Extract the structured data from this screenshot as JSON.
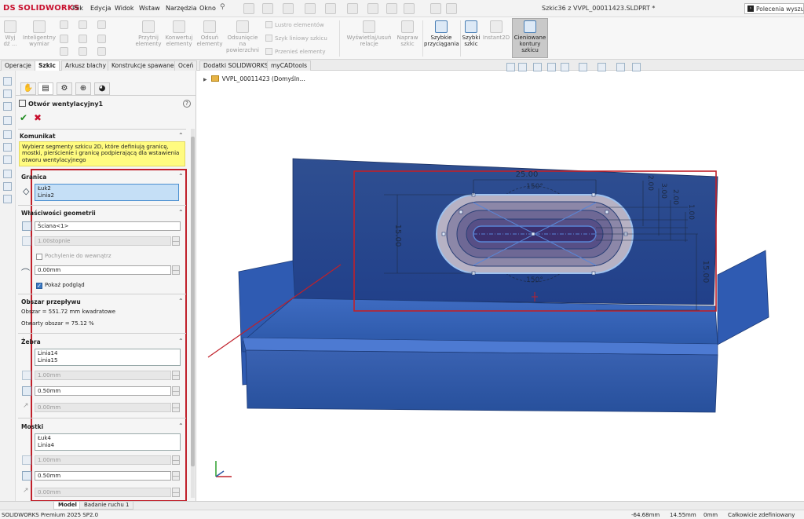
{
  "app": {
    "logo_text": "SOLIDWORKS",
    "document_title": "Szkic36 z VVPL_00011423.SLDPRT *",
    "search_placeholder": "Polecenia wyszuk",
    "menu": [
      "Plik",
      "Edycja",
      "Widok",
      "Wstaw",
      "Narzędzia",
      "Okno"
    ]
  },
  "ribbon": {
    "tools": [
      {
        "label": "Wyj\ndź ...",
        "enabled": false
      },
      {
        "label": "Inteligentny\nwymiar",
        "enabled": false
      },
      {
        "label": "Przytnij\nelementy",
        "enabled": false
      },
      {
        "label": "Konwertuj\nelementy",
        "enabled": false
      },
      {
        "label": "Odsuń\nelementy",
        "enabled": false
      },
      {
        "label": "Odsunięcie\nna\npowierzchni",
        "enabled": false
      },
      {
        "label": "Wyświetlaj/usuń\nrelacje",
        "enabled": false
      },
      {
        "label": "Napraw\nszkic",
        "enabled": false
      },
      {
        "label": "Szybkie\nprzyciągania",
        "enabled": true
      },
      {
        "label": "Szybki\nszkic",
        "enabled": true
      },
      {
        "label": "Instant2D",
        "enabled": false
      },
      {
        "label": "Cieniowane\nkontury\nszkicu",
        "enabled": true,
        "selected": true
      }
    ],
    "small_items": [
      "Lustro elementów",
      "Szyk liniowy szkicu",
      "Przenieś elementy"
    ]
  },
  "command_tabs": [
    "Operacje",
    "Szkic",
    "Arkusz blachy",
    "Konstrukcje spawane",
    "Oceń",
    "Dodatki SOLIDWORKS",
    "myCADtools"
  ],
  "active_tab": "Szkic",
  "property_manager": {
    "title": "Otwór wentylacyjny1",
    "message_title": "Komunikat",
    "message": "Wybierz segmenty szkicu 2D, które definiują granicę, mostki, pierścienie i granicę podpierającą dla wstawienia otworu wentylacyjnego",
    "boundary": {
      "title": "Granica",
      "items": [
        "Łuk2",
        "Linia2"
      ]
    },
    "geometry": {
      "title": "Właściwości geometrii",
      "face": "Ściana<1>",
      "draft_angle": "1.00stopnie",
      "draft_inward_label": "Pochylenie do wewnątrz",
      "fillet_radius": "0.00mm",
      "show_preview_label": "Pokaż podgląd"
    },
    "flow_area": {
      "title": "Obszar przepływu",
      "area": "Obszar = 551.72 mm kwadratowe",
      "open_area": "Otwarty obszar = 75.12 %"
    },
    "ribs": {
      "title": "Żebra",
      "items": [
        "Linia14",
        "Linia15"
      ],
      "depth": "1.00mm",
      "width": "0.50mm",
      "offset": "0.00mm"
    },
    "spars": {
      "title": "Mostki",
      "items": [
        "Łuk4",
        "Linia4"
      ],
      "depth": "1.00mm",
      "width": "0.50mm",
      "offset": "0.00mm"
    }
  },
  "viewport": {
    "tree_item": "VVPL_00011423 (Domyśln...",
    "dimensions": {
      "top_width": "25.00",
      "angle_top": "150°",
      "angle_bottom": "150°",
      "left_height": "15.00",
      "right_height": "15.00",
      "v1": "2.00",
      "v2": "3.00",
      "v3": "2.00",
      "v4": "1.00"
    }
  },
  "bottom_tabs": [
    "Model",
    "Badanie ruchu 1"
  ],
  "status_bar": {
    "product": "SOLIDWORKS Premium 2025 SP2.0",
    "x": "-64.68mm",
    "y": "14.55mm",
    "z": "0mm",
    "state": "Całkowicie zdefiniowany"
  },
  "colors": {
    "accent": "#c0202a",
    "panel_blue": "#2d5aa5",
    "message_bg": "#fffb80"
  }
}
